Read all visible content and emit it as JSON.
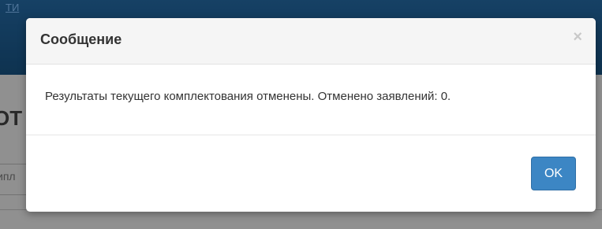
{
  "background": {
    "header_link": "ТИ",
    "title_fragment": "ОТ",
    "tab_fragment": "ипл"
  },
  "dialog": {
    "title": "Сообщение",
    "close_glyph": "×",
    "message": "Результаты текущего комплектования отменены. Отменено заявлений: 0.",
    "ok_label": "OK"
  },
  "colors": {
    "primary_button": "#3c86c4",
    "header_background": "#f5f5f5",
    "app_header": "#1f5a8c"
  }
}
